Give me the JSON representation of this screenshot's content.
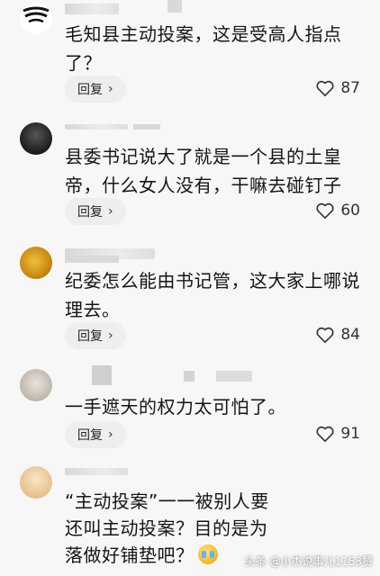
{
  "comments": [
    {
      "text": "毛知县主动投案，这是受高人指点了？",
      "reply_label": "回复",
      "likes": "87"
    },
    {
      "text": "县委书记说大了就是一个县的土皇帝，什么女人没有，干嘛去碰钉子",
      "reply_label": "回复",
      "likes": "60"
    },
    {
      "text": "纪委怎么能由书记管，这大家上哪说理去。",
      "reply_label": "回复",
      "likes": "84"
    },
    {
      "text": "一手遮天的权力太可怕了。",
      "reply_label": "回复",
      "likes": "91"
    },
    {
      "text": "“主动投案”一一被别人要还叫主动投案？目的是为落做好铺垫吧？",
      "line1": "“主动投案”一一被别人要",
      "line2": "还叫主动投案？目的是为",
      "line3": "落做好铺垫吧？"
    }
  ],
  "watermark": "头条 @小杰说事儿1153赞",
  "icons": {
    "like": "heart-outline-icon",
    "reply_chevron": "chevron-right-icon",
    "emoji": "crying-face-emoji"
  }
}
